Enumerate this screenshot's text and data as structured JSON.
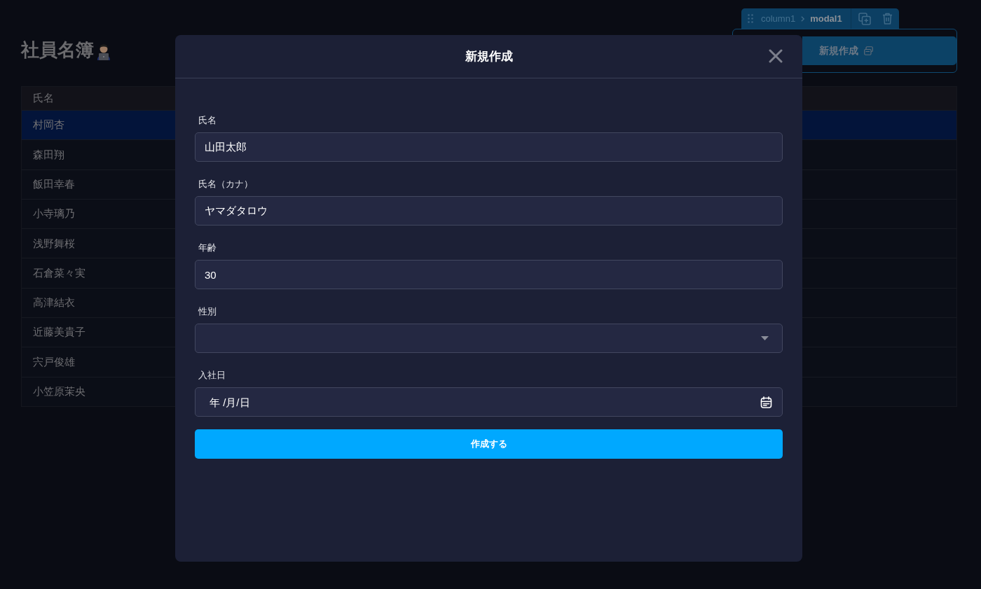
{
  "page": {
    "title": "社員名簿"
  },
  "toolbar": {
    "breadcrumb": [
      {
        "label": "column1",
        "selected": false
      },
      {
        "label": "modal1",
        "selected": true
      }
    ]
  },
  "open_button": {
    "label": "新規作成"
  },
  "table": {
    "columns": [
      "氏名"
    ],
    "rows": [
      {
        "name": "村岡杏",
        "selected": true
      },
      {
        "name": "森田翔",
        "selected": false
      },
      {
        "name": "飯田幸春",
        "selected": false
      },
      {
        "name": "小寺璃乃",
        "selected": false
      },
      {
        "name": "浅野舞桜",
        "selected": false
      },
      {
        "name": "石倉菜々実",
        "selected": false
      },
      {
        "name": "高津結衣",
        "selected": false
      },
      {
        "name": "近藤美貴子",
        "selected": false
      },
      {
        "name": "宍戸俊雄",
        "selected": false
      },
      {
        "name": "小笠原茉央",
        "selected": false
      }
    ]
  },
  "modal": {
    "title": "新規作成",
    "fields": [
      {
        "label": "氏名",
        "kind": "text",
        "value": "山田太郎"
      },
      {
        "label": "氏名（カナ）",
        "kind": "text",
        "value": "ヤマダタロウ"
      },
      {
        "label": "年齢",
        "kind": "number",
        "value": "30"
      },
      {
        "label": "性別",
        "kind": "select"
      },
      {
        "label": "入社日",
        "kind": "date",
        "placeholder": "年 /月/日"
      }
    ],
    "submit": "作成する"
  }
}
